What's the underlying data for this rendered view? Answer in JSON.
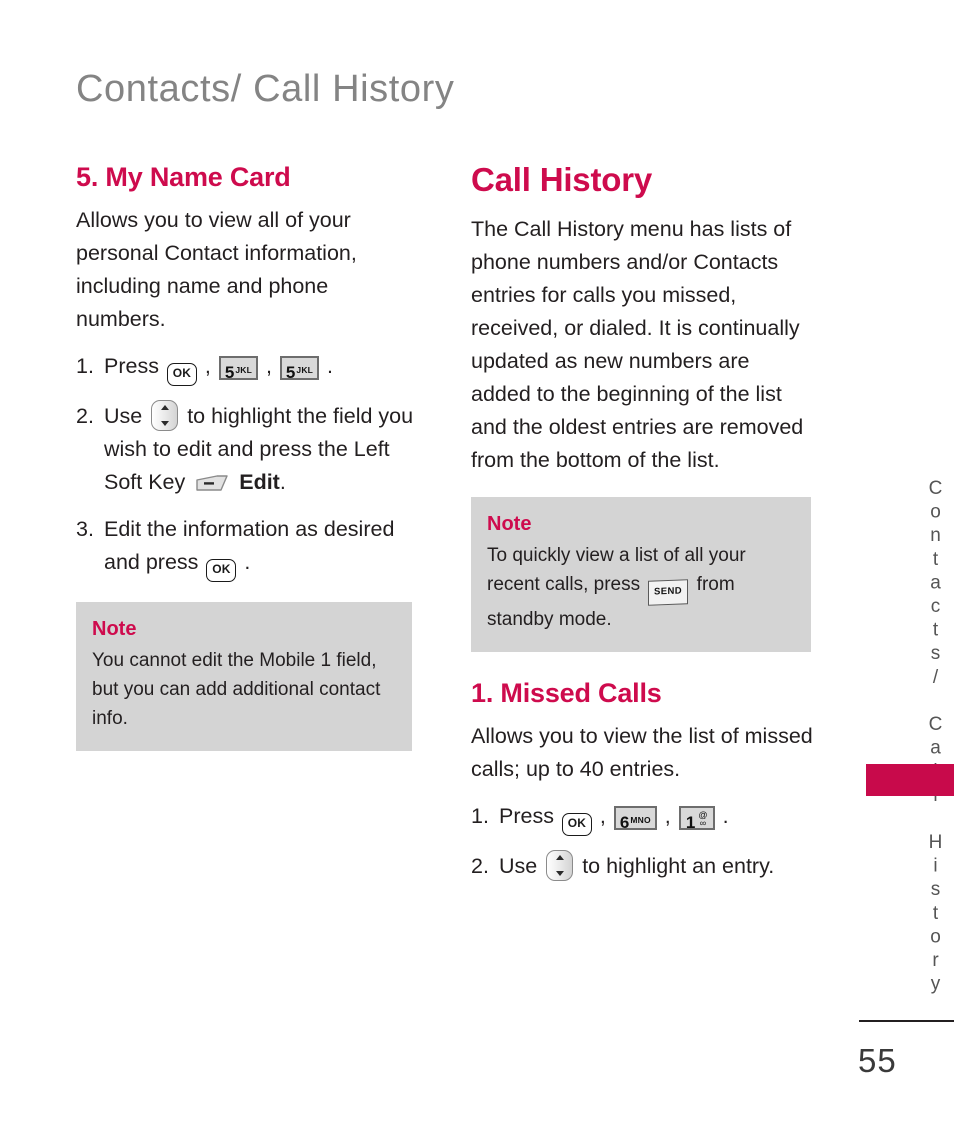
{
  "page": {
    "running_head": "Contacts/ Call History",
    "page_number": "55",
    "edge_tab_label": "Contacts/ Call History",
    "accent_color": "#ce0b4d",
    "tab_color": "#c80a4b",
    "note_bg_color": "#d4d4d4"
  },
  "left_column": {
    "heading": "5. My Name Card",
    "intro": "Allows you to view all of your personal Contact information, including name and phone numbers.",
    "steps": [
      {
        "num": "1.",
        "parts": [
          {
            "type": "text",
            "value": "Press "
          },
          {
            "type": "key",
            "style": "ok",
            "label": "OK"
          },
          {
            "type": "text",
            "value": " , "
          },
          {
            "type": "key",
            "style": "num",
            "digit": "5",
            "letters": "JKL"
          },
          {
            "type": "text",
            "value": " ,  "
          },
          {
            "type": "key",
            "style": "num",
            "digit": "5",
            "letters": "JKL"
          },
          {
            "type": "text",
            "value": " ."
          }
        ]
      },
      {
        "num": "2.",
        "parts": [
          {
            "type": "text",
            "value": "Use "
          },
          {
            "type": "key",
            "style": "nav",
            "label": "up-down-navigation-key"
          },
          {
            "type": "text",
            "value": " to highlight the field you wish to edit and press the Left Soft Key "
          },
          {
            "type": "key",
            "style": "soft",
            "label": "left-soft-key"
          },
          {
            "type": "bold",
            "value": " Edit"
          },
          {
            "type": "text",
            "value": "."
          }
        ]
      },
      {
        "num": "3.",
        "parts": [
          {
            "type": "text",
            "value": "Edit the information as desired and press "
          },
          {
            "type": "key",
            "style": "ok",
            "label": "OK"
          },
          {
            "type": "text",
            "value": " ."
          }
        ]
      }
    ],
    "note": {
      "title": "Note",
      "text": "You cannot edit the Mobile 1 field, but you can add additional contact info."
    }
  },
  "right_column": {
    "heading": "Call History",
    "intro": "The Call History menu has lists of phone numbers and/or Contacts entries for calls you missed, received, or dialed. It is continually updated as new numbers are added to the beginning of the list and the oldest entries are removed from the bottom of the list.",
    "note": {
      "title": "Note",
      "text_before": "To quickly view a list of all your recent calls, press ",
      "key_label": "SEND",
      "text_after": " from standby mode."
    },
    "subheading": "1. Missed Calls",
    "sub_intro": "Allows you to view the list of missed calls; up to 40 entries.",
    "steps": [
      {
        "num": "1.",
        "parts": [
          {
            "type": "text",
            "value": "Press "
          },
          {
            "type": "key",
            "style": "ok",
            "label": "OK"
          },
          {
            "type": "text",
            "value": " , "
          },
          {
            "type": "key",
            "style": "num",
            "digit": "6",
            "letters": "MNO"
          },
          {
            "type": "text",
            "value": " ,  "
          },
          {
            "type": "key",
            "style": "num",
            "digit": "1",
            "symbol_top": "@",
            "symbol_bottom": "∞"
          },
          {
            "type": "text",
            "value": " ."
          }
        ]
      },
      {
        "num": "2.",
        "parts": [
          {
            "type": "text",
            "value": "Use "
          },
          {
            "type": "key",
            "style": "nav",
            "label": "up-down-navigation-key"
          },
          {
            "type": "text",
            "value": " to highlight an entry."
          }
        ]
      }
    ]
  }
}
